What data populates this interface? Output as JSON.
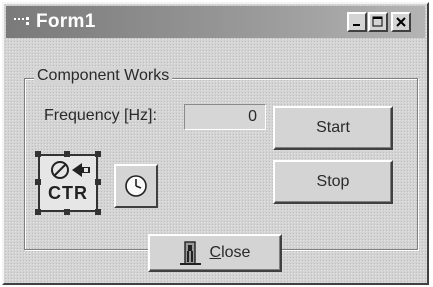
{
  "window": {
    "title": "Form1"
  },
  "titlebar_buttons": [
    {
      "name": "minimize",
      "icon": "minimize-icon"
    },
    {
      "name": "maximize",
      "icon": "maximize-icon"
    },
    {
      "name": "close",
      "icon": "close-x-icon"
    }
  ],
  "group": {
    "label": "Component Works"
  },
  "frequency": {
    "label": "Frequency [Hz]:",
    "value": "0"
  },
  "buttons": {
    "start": "Start",
    "stop": "Stop"
  },
  "components": {
    "counter_label": "CTR",
    "counter_icon": "counter-component-icon",
    "timer_icon": "clock-icon"
  },
  "close_button": {
    "mnemonic": "C",
    "rest": "lose",
    "icon": "exit-figure-icon"
  }
}
